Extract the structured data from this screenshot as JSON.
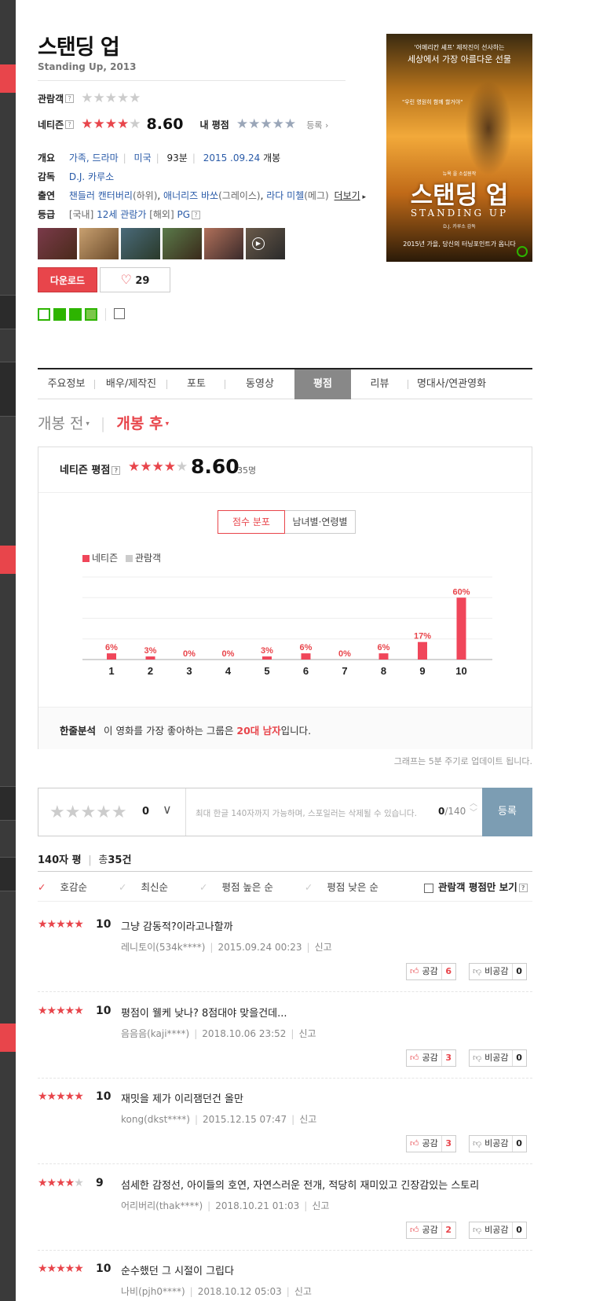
{
  "movie": {
    "title": "스탠딩 업",
    "subtitle": "Standing Up, 2013",
    "audience_label": "관람객",
    "netizen_label": "네티즌",
    "netizen_score": "8.60",
    "my_rating_label": "내 평점",
    "register_link": "등록",
    "info": {
      "overview_label": "개요",
      "genre": "가족, 드라마",
      "country": "미국",
      "runtime": "93분",
      "release_date": "2015 .09.24",
      "release_suffix": "개봉",
      "director_label": "감독",
      "director": "D.J. 카루소",
      "cast_label": "출연",
      "cast": [
        "챈들러 캔터버리",
        "(하위)",
        "애너리즈 바쏘",
        "(그레이스)",
        "라다 미첼",
        "(메그)"
      ],
      "cast_more": "더보기",
      "grade_label": "등급",
      "grade_domestic_prefix": "[국내]",
      "grade_domestic": "12세 관람가",
      "grade_foreign_prefix": "[해외]",
      "grade_foreign": "PG"
    },
    "download_label": "다운로드",
    "like_count": "29",
    "poster": {
      "tagline_top1": "'어메리칸 셰프' 제작진이 선사하는",
      "tagline_top2": "세상에서 가장 아름다운 선물",
      "tagline_mid": "\"우린 영원히 함께 할거야\"",
      "small_top": "뉴욕 을 소설원작",
      "title_kr": "스탠딩 업",
      "title_en": "STANDING UP",
      "credit": "D.J. 카루소 감독",
      "bottom": "2015년 가을, 당신의 터닝포인트가 옵니다"
    }
  },
  "tabs": [
    "주요정보",
    "배우/제작진",
    "포토",
    "동영상",
    "평점",
    "리뷰",
    "명대사/연관영화"
  ],
  "active_tab": "평점",
  "pre_release": "개봉 전",
  "post_release": "개봉 후",
  "rating_box": {
    "title": "네티즌 평점",
    "score": "8.60",
    "count": "35명",
    "toggle_on": "점수 분포",
    "toggle_off": "남녀별·연령별",
    "legend_netizen": "네티즌",
    "legend_audience": "관람객",
    "analysis_label": "한줄분석",
    "analysis_pre": "이 영화를 가장 좋아하는 그룹은 ",
    "analysis_highlight": "20대 남자",
    "analysis_post": "입니다."
  },
  "chart_data": {
    "type": "bar",
    "categories": [
      "1",
      "2",
      "3",
      "4",
      "5",
      "6",
      "7",
      "8",
      "9",
      "10"
    ],
    "series": [
      {
        "name": "네티즌",
        "values": [
          6,
          3,
          0,
          0,
          3,
          6,
          0,
          6,
          17,
          60
        ]
      }
    ],
    "value_labels": [
      "6%",
      "3%",
      "0%",
      "0%",
      "3%",
      "6%",
      "0%",
      "6%",
      "17%",
      "60%"
    ],
    "ylim": [
      0,
      80
    ],
    "colors": {
      "netizen": "#f0465a",
      "audience": "#cccccc"
    }
  },
  "update_note": "그래프는 5분 주기로 업데이트 됩니다.",
  "input": {
    "score": "0",
    "placeholder": "최대 한글 140자까지 가능하며, 스포일러는 삭제될 수 있습니다.",
    "char_count": "0",
    "char_max": "/140",
    "submit": "등록"
  },
  "reviews_header": {
    "title": "140자 평",
    "total_prefix": "총",
    "total": "35건",
    "sorts": [
      "호감순",
      "최신순",
      "평점 높은 순",
      "평점 낮은 순"
    ],
    "audience_only": "관람객 평점만 보기"
  },
  "reviews": [
    {
      "stars": "★★★★★",
      "score": "10",
      "text": "그냥 감동적?이라고나할까",
      "user": "레니토이(534k****)",
      "date": "2015.09.24 00:23",
      "report": "신고",
      "like": "6",
      "dislike": "0"
    },
    {
      "stars": "★★★★★",
      "score": "10",
      "text": "평점이 웰케 낮나? 8점대야 맞을건데...",
      "user": "음음음(kaji****)",
      "date": "2018.10.06 23:52",
      "report": "신고",
      "like": "3",
      "dislike": "0"
    },
    {
      "stars": "★★★★★",
      "score": "10",
      "text": "재밋을 제가 이리잼던건 올만",
      "user": "kong(dkst****)",
      "date": "2015.12.15 07:47",
      "report": "신고",
      "like": "3",
      "dislike": "0"
    },
    {
      "stars": "★★★★☆",
      "score": "9",
      "text": "섬세한 감정선, 아이들의 호연, 자연스러운 전개, 적당히 재미있고 긴장감있는 스토리",
      "user": "어리버리(thak****)",
      "date": "2018.10.21 01:03",
      "report": "신고",
      "like": "2",
      "dislike": "0"
    },
    {
      "stars": "★★★★★",
      "score": "10",
      "text": "순수했던 그 시절이 그립다",
      "user": "나비(pjh0****)",
      "date": "2018.10.12 05:03",
      "report": "신고",
      "like": "",
      "dislike": ""
    }
  ],
  "vote_labels": {
    "like": "공감",
    "dislike": "비공감"
  }
}
